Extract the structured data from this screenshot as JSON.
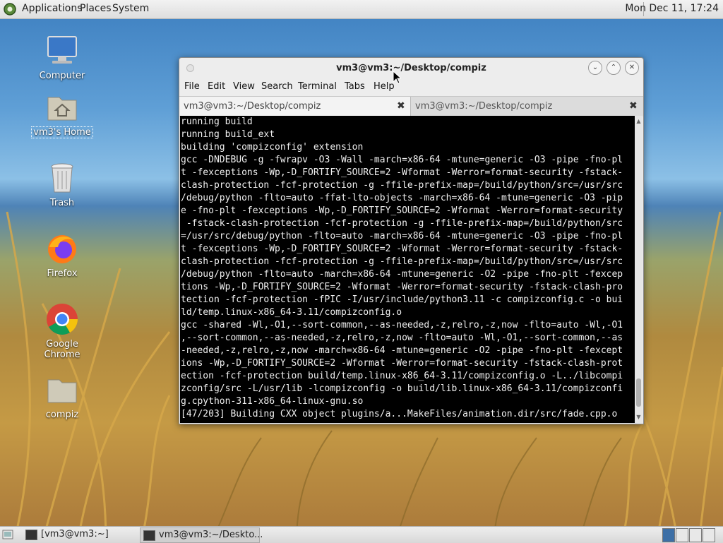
{
  "top_panel": {
    "menus": [
      "Applications",
      "Places",
      "System"
    ],
    "clock": "Mon Dec 11, 17:24"
  },
  "desktop_icons": [
    {
      "label": "Computer",
      "icon": "computer-icon"
    },
    {
      "label": "vm3's Home",
      "icon": "home-folder-icon"
    },
    {
      "label": "Trash",
      "icon": "trash-icon"
    },
    {
      "label": "Firefox",
      "icon": "firefox-icon"
    },
    {
      "label": "Google Chrome",
      "icon": "chrome-icon"
    },
    {
      "label": "compiz",
      "icon": "folder-icon"
    }
  ],
  "window": {
    "title": "vm3@vm3:~/Desktop/compiz",
    "menu": [
      "File",
      "Edit",
      "View",
      "Search",
      "Terminal",
      "Tabs",
      "Help"
    ],
    "tabs": [
      {
        "label": "vm3@vm3:~/Desktop/compiz",
        "active": true
      },
      {
        "label": "vm3@vm3:~/Desktop/compiz",
        "active": false
      }
    ],
    "lines": [
      "running build",
      "running build_ext",
      "building 'compizconfig' extension",
      "gcc -DNDEBUG -g -fwrapv -O3 -Wall -march=x86-64 -mtune=generic -O3 -pipe -fno-pl",
      "t -fexceptions -Wp,-D_FORTIFY_SOURCE=2 -Wformat -Werror=format-security -fstack-",
      "clash-protection -fcf-protection -g -ffile-prefix-map=/build/python/src=/usr/src",
      "/debug/python -flto=auto -ffat-lto-objects -march=x86-64 -mtune=generic -O3 -pip",
      "e -fno-plt -fexceptions -Wp,-D_FORTIFY_SOURCE=2 -Wformat -Werror=format-security",
      " -fstack-clash-protection -fcf-protection -g -ffile-prefix-map=/build/python/src",
      "=/usr/src/debug/python -flto=auto -march=x86-64 -mtune=generic -O3 -pipe -fno-pl",
      "t -fexceptions -Wp,-D_FORTIFY_SOURCE=2 -Wformat -Werror=format-security -fstack-",
      "clash-protection -fcf-protection -g -ffile-prefix-map=/build/python/src=/usr/src",
      "/debug/python -flto=auto -march=x86-64 -mtune=generic -O2 -pipe -fno-plt -fexcep",
      "tions -Wp,-D_FORTIFY_SOURCE=2 -Wformat -Werror=format-security -fstack-clash-pro",
      "tection -fcf-protection -fPIC -I/usr/include/python3.11 -c compizconfig.c -o bui",
      "ld/temp.linux-x86_64-3.11/compizconfig.o",
      "gcc -shared -Wl,-O1,--sort-common,--as-needed,-z,relro,-z,now -flto=auto -Wl,-O1",
      ",--sort-common,--as-needed,-z,relro,-z,now -flto=auto -Wl,-O1,--sort-common,--as",
      "-needed,-z,relro,-z,now -march=x86-64 -mtune=generic -O2 -pipe -fno-plt -fexcept",
      "ions -Wp,-D_FORTIFY_SOURCE=2 -Wformat -Werror=format-security -fstack-clash-prot",
      "ection -fcf-protection build/temp.linux-x86_64-3.11/compizconfig.o -L../libcompi",
      "zconfig/src -L/usr/lib -lcompizconfig -o build/lib.linux-x86_64-3.11/compizconfi",
      "g.cpython-311-x86_64-linux-gnu.so",
      "[47/203] Building CXX object plugins/a...MakeFiles/animation.dir/src/fade.cpp.o"
    ]
  },
  "bottom_panel": {
    "tasks": [
      {
        "label": "[vm3@vm3:~]",
        "active": false
      },
      {
        "label": "vm3@vm3:~/Deskto...",
        "active": true
      }
    ]
  }
}
